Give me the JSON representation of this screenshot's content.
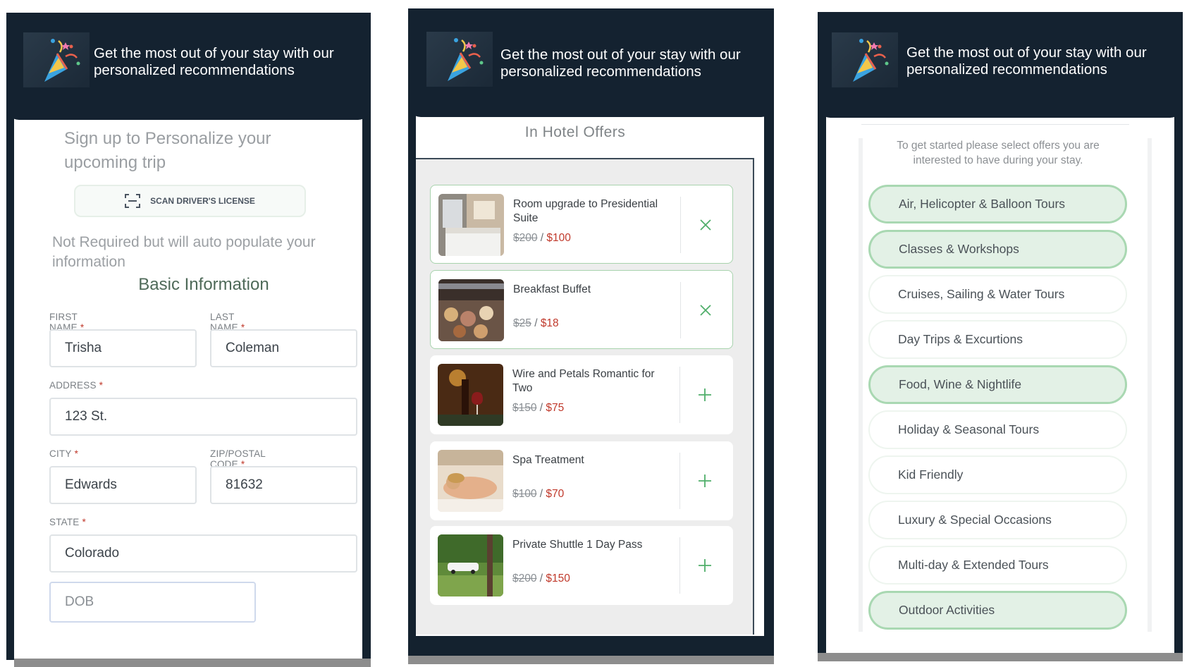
{
  "header": {
    "text": "Get the most out of your stay with our personalized recommendations"
  },
  "signup": {
    "title": "Sign up to Personalize your upcoming trip",
    "scan_button": "SCAN DRIVER'S LICENSE",
    "note": "Not Required but will auto populate your information",
    "section_title": "Basic Information",
    "required_mark": "*",
    "fields": {
      "first_name": {
        "label": "FIRST NAME",
        "value": "Trisha"
      },
      "last_name": {
        "label": "LAST NAME",
        "value": "Coleman"
      },
      "address": {
        "label": "ADDRESS",
        "value": "123 St."
      },
      "city": {
        "label": "CITY",
        "value": "Edwards"
      },
      "zip": {
        "label": "ZIP/POSTAL CODE",
        "value": "81632"
      },
      "state": {
        "label": "STATE",
        "value": "Colorado"
      },
      "dob": {
        "placeholder": "DOB"
      }
    }
  },
  "offers": {
    "title": "In Hotel Offers",
    "items": [
      {
        "name": "Room upgrade to Presidential Suite",
        "old_price": "$200",
        "new_price": "$100",
        "selected": true,
        "action_icon": "close-icon"
      },
      {
        "name": "Breakfast Buffet",
        "old_price": "$25",
        "new_price": "$18",
        "selected": true,
        "action_icon": "close-icon"
      },
      {
        "name": "Wire and Petals Romantic for Two",
        "old_price": "$150",
        "new_price": "$75",
        "selected": false,
        "action_icon": "plus-icon"
      },
      {
        "name": "Spa Treatment",
        "old_price": "$100",
        "new_price": "$70",
        "selected": false,
        "action_icon": "plus-icon"
      },
      {
        "name": "Private Shuttle 1 Day Pass",
        "old_price": "$200",
        "new_price": "$150",
        "selected": false,
        "action_icon": "plus-icon"
      }
    ],
    "price_separator": "/"
  },
  "interests": {
    "intro": "To get started please select offers you are interested to have during your stay.",
    "categories": [
      {
        "label": "Air, Helicopter & Balloon Tours",
        "selected": true
      },
      {
        "label": "Classes & Workshops",
        "selected": true
      },
      {
        "label": "Cruises, Sailing & Water Tours",
        "selected": false
      },
      {
        "label": "Day Trips & Excurtions",
        "selected": false
      },
      {
        "label": "Food, Wine & Nightlife",
        "selected": true
      },
      {
        "label": "Holiday & Seasonal Tours",
        "selected": false
      },
      {
        "label": "Kid Friendly",
        "selected": false
      },
      {
        "label": "Luxury & Special Occasions",
        "selected": false
      },
      {
        "label": "Multi-day & Extended Tours",
        "selected": false
      },
      {
        "label": "Outdoor Activities",
        "selected": true
      }
    ]
  },
  "colors": {
    "header_bg": "#142230",
    "accent_green": "#a9d8b2",
    "price_red": "#c0392b"
  }
}
